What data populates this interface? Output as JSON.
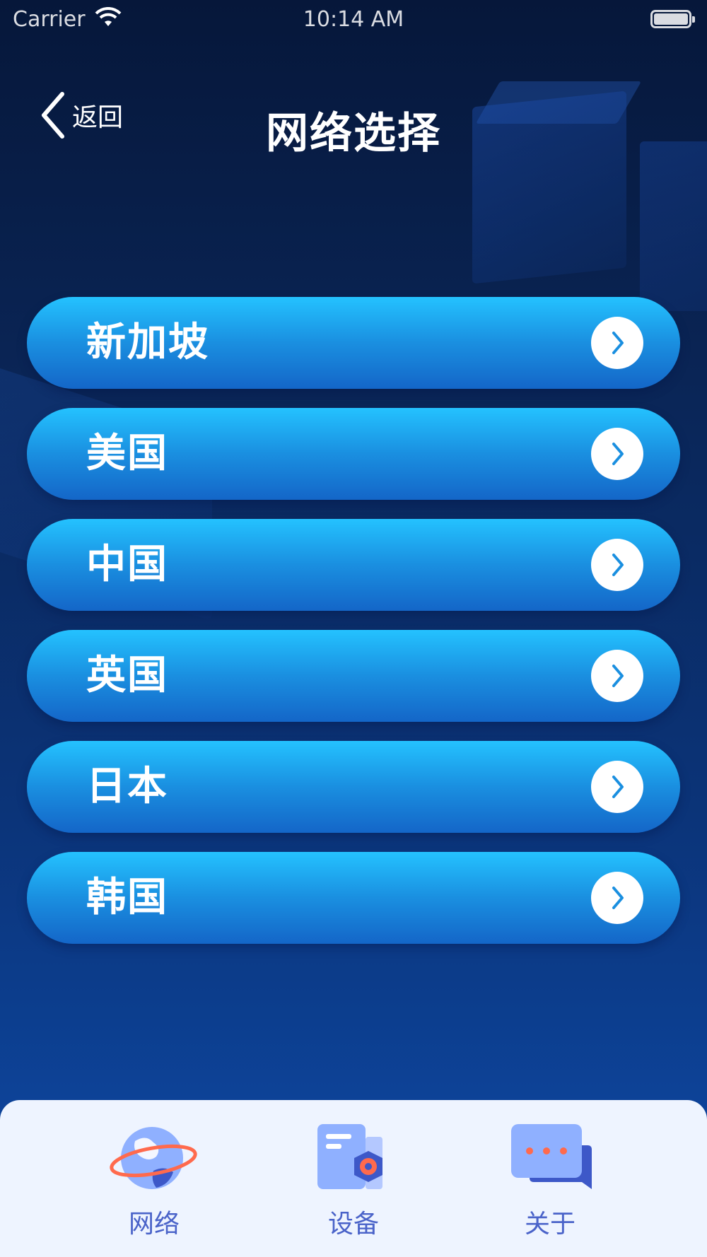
{
  "status_bar": {
    "carrier": "Carrier",
    "time": "10:14 AM",
    "wifi_icon": "wifi-icon",
    "battery_icon": "battery-icon"
  },
  "nav": {
    "back_label": "返回",
    "back_icon": "chevron-left-icon",
    "title": "网络选择"
  },
  "networks": [
    {
      "label": "新加坡",
      "icon": "chevron-right-icon"
    },
    {
      "label": "美国",
      "icon": "chevron-right-icon"
    },
    {
      "label": "中国",
      "icon": "chevron-right-icon"
    },
    {
      "label": "英国",
      "icon": "chevron-right-icon"
    },
    {
      "label": "日本",
      "icon": "chevron-right-icon"
    },
    {
      "label": "韩国",
      "icon": "chevron-right-icon"
    }
  ],
  "tab_bar": {
    "tabs": [
      {
        "label": "网络",
        "icon": "globe-icon"
      },
      {
        "label": "设备",
        "icon": "device-settings-icon"
      },
      {
        "label": "关于",
        "icon": "chat-bubble-icon"
      }
    ]
  },
  "colors": {
    "background_top": "#06173a",
    "background_bottom": "#0e4aa8",
    "row_gradient_top": "#24c2ff",
    "row_gradient_bottom": "#1466c8",
    "arrow_color": "#1a8fe0",
    "tab_bar_bg": "#eef4ff",
    "tab_label": "#4a63c9",
    "accent_orange": "#ff6a4d"
  }
}
